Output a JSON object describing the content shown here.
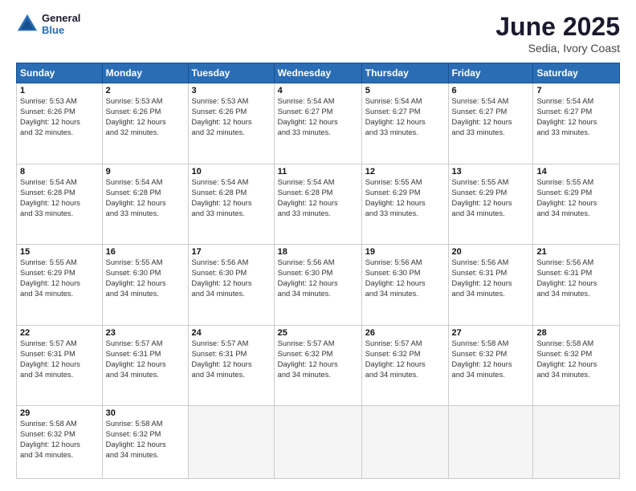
{
  "header": {
    "logo_line1": "General",
    "logo_line2": "Blue",
    "month": "June 2025",
    "location": "Sedia, Ivory Coast"
  },
  "weekdays": [
    "Sunday",
    "Monday",
    "Tuesday",
    "Wednesday",
    "Thursday",
    "Friday",
    "Saturday"
  ],
  "weeks": [
    [
      {
        "day": "1",
        "info": "Sunrise: 5:53 AM\nSunset: 6:26 PM\nDaylight: 12 hours\nand 32 minutes."
      },
      {
        "day": "2",
        "info": "Sunrise: 5:53 AM\nSunset: 6:26 PM\nDaylight: 12 hours\nand 32 minutes."
      },
      {
        "day": "3",
        "info": "Sunrise: 5:53 AM\nSunset: 6:26 PM\nDaylight: 12 hours\nand 32 minutes."
      },
      {
        "day": "4",
        "info": "Sunrise: 5:54 AM\nSunset: 6:27 PM\nDaylight: 12 hours\nand 33 minutes."
      },
      {
        "day": "5",
        "info": "Sunrise: 5:54 AM\nSunset: 6:27 PM\nDaylight: 12 hours\nand 33 minutes."
      },
      {
        "day": "6",
        "info": "Sunrise: 5:54 AM\nSunset: 6:27 PM\nDaylight: 12 hours\nand 33 minutes."
      },
      {
        "day": "7",
        "info": "Sunrise: 5:54 AM\nSunset: 6:27 PM\nDaylight: 12 hours\nand 33 minutes."
      }
    ],
    [
      {
        "day": "8",
        "info": "Sunrise: 5:54 AM\nSunset: 6:28 PM\nDaylight: 12 hours\nand 33 minutes."
      },
      {
        "day": "9",
        "info": "Sunrise: 5:54 AM\nSunset: 6:28 PM\nDaylight: 12 hours\nand 33 minutes."
      },
      {
        "day": "10",
        "info": "Sunrise: 5:54 AM\nSunset: 6:28 PM\nDaylight: 12 hours\nand 33 minutes."
      },
      {
        "day": "11",
        "info": "Sunrise: 5:54 AM\nSunset: 6:28 PM\nDaylight: 12 hours\nand 33 minutes."
      },
      {
        "day": "12",
        "info": "Sunrise: 5:55 AM\nSunset: 6:29 PM\nDaylight: 12 hours\nand 33 minutes."
      },
      {
        "day": "13",
        "info": "Sunrise: 5:55 AM\nSunset: 6:29 PM\nDaylight: 12 hours\nand 34 minutes."
      },
      {
        "day": "14",
        "info": "Sunrise: 5:55 AM\nSunset: 6:29 PM\nDaylight: 12 hours\nand 34 minutes."
      }
    ],
    [
      {
        "day": "15",
        "info": "Sunrise: 5:55 AM\nSunset: 6:29 PM\nDaylight: 12 hours\nand 34 minutes."
      },
      {
        "day": "16",
        "info": "Sunrise: 5:55 AM\nSunset: 6:30 PM\nDaylight: 12 hours\nand 34 minutes."
      },
      {
        "day": "17",
        "info": "Sunrise: 5:56 AM\nSunset: 6:30 PM\nDaylight: 12 hours\nand 34 minutes."
      },
      {
        "day": "18",
        "info": "Sunrise: 5:56 AM\nSunset: 6:30 PM\nDaylight: 12 hours\nand 34 minutes."
      },
      {
        "day": "19",
        "info": "Sunrise: 5:56 AM\nSunset: 6:30 PM\nDaylight: 12 hours\nand 34 minutes."
      },
      {
        "day": "20",
        "info": "Sunrise: 5:56 AM\nSunset: 6:31 PM\nDaylight: 12 hours\nand 34 minutes."
      },
      {
        "day": "21",
        "info": "Sunrise: 5:56 AM\nSunset: 6:31 PM\nDaylight: 12 hours\nand 34 minutes."
      }
    ],
    [
      {
        "day": "22",
        "info": "Sunrise: 5:57 AM\nSunset: 6:31 PM\nDaylight: 12 hours\nand 34 minutes."
      },
      {
        "day": "23",
        "info": "Sunrise: 5:57 AM\nSunset: 6:31 PM\nDaylight: 12 hours\nand 34 minutes."
      },
      {
        "day": "24",
        "info": "Sunrise: 5:57 AM\nSunset: 6:31 PM\nDaylight: 12 hours\nand 34 minutes."
      },
      {
        "day": "25",
        "info": "Sunrise: 5:57 AM\nSunset: 6:32 PM\nDaylight: 12 hours\nand 34 minutes."
      },
      {
        "day": "26",
        "info": "Sunrise: 5:57 AM\nSunset: 6:32 PM\nDaylight: 12 hours\nand 34 minutes."
      },
      {
        "day": "27",
        "info": "Sunrise: 5:58 AM\nSunset: 6:32 PM\nDaylight: 12 hours\nand 34 minutes."
      },
      {
        "day": "28",
        "info": "Sunrise: 5:58 AM\nSunset: 6:32 PM\nDaylight: 12 hours\nand 34 minutes."
      }
    ],
    [
      {
        "day": "29",
        "info": "Sunrise: 5:58 AM\nSunset: 6:32 PM\nDaylight: 12 hours\nand 34 minutes."
      },
      {
        "day": "30",
        "info": "Sunrise: 5:58 AM\nSunset: 6:32 PM\nDaylight: 12 hours\nand 34 minutes."
      },
      null,
      null,
      null,
      null,
      null
    ]
  ]
}
